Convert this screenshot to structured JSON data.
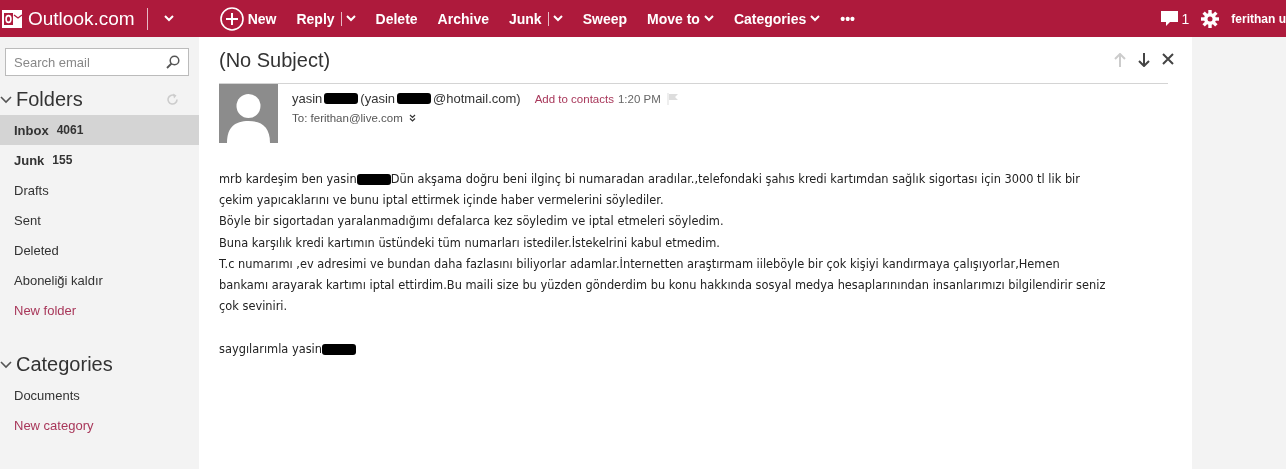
{
  "topbar": {
    "brand": "Outlook.com",
    "actions": [
      {
        "label": "New",
        "kind": "new"
      },
      {
        "label": "Reply",
        "kind": "split"
      },
      {
        "label": "Delete",
        "kind": "plain"
      },
      {
        "label": "Archive",
        "kind": "plain"
      },
      {
        "label": "Junk",
        "kind": "split"
      },
      {
        "label": "Sweep",
        "kind": "plain"
      },
      {
        "label": "Move to",
        "kind": "menu"
      },
      {
        "label": "Categories",
        "kind": "menu"
      },
      {
        "label": "•••",
        "kind": "plain"
      }
    ],
    "messages_count": "1",
    "user": "ferithan u"
  },
  "sidebar": {
    "search": {
      "placeholder": "Search email"
    },
    "folders_title": "Folders",
    "folders": [
      {
        "label": "Inbox",
        "count": "4061",
        "selected": true,
        "kind": "folder"
      },
      {
        "label": "Junk",
        "count": "155",
        "selected": false,
        "kind": "folder"
      },
      {
        "label": "Drafts",
        "selected": false,
        "kind": "folder"
      },
      {
        "label": "Sent",
        "selected": false,
        "kind": "folder"
      },
      {
        "label": "Deleted",
        "selected": false,
        "kind": "folder"
      },
      {
        "label": "Aboneliği kaldır",
        "selected": false,
        "kind": "folder"
      },
      {
        "label": "New folder",
        "selected": false,
        "kind": "link"
      }
    ],
    "categories_title": "Categories",
    "categories": [
      {
        "label": "Documents",
        "kind": "folder"
      },
      {
        "label": "New category",
        "kind": "link"
      }
    ]
  },
  "message": {
    "subject": "(No Subject)",
    "from": [
      {
        "kind": "text",
        "text": "yasin"
      },
      {
        "kind": "redaction"
      },
      {
        "kind": "text",
        "text": "(yasin"
      },
      {
        "kind": "redaction"
      },
      {
        "kind": "text",
        "text": "@hotmail.com)"
      }
    ],
    "add_contact": "Add to contacts",
    "time": "1:20 PM",
    "to": "To: ferithan@live.com",
    "body": [
      [
        [
          {
            "kind": "text",
            "text": "mrb kardeşim ben yasin"
          },
          {
            "kind": "redaction"
          },
          {
            "kind": "text",
            "text": "Dün akşama doğru beni ilginç bi numaradan aradılar.,telefondaki şahıs  kredi kartımdan sağlık sigortası için 3000 tl lik bir"
          }
        ],
        [
          {
            "kind": "text",
            "text": "çekim yapıcaklarını ve bunu iptal ettirmek içinde haber vermelerini söylediler."
          }
        ],
        [
          {
            "kind": "text",
            "text": "Böyle bir sigortadan yaralanmadığımı defalarca kez söyledim ve iptal etmeleri söyledim."
          }
        ],
        [
          {
            "kind": "text",
            "text": "Buna karşılık kredi kartımın üstündeki tüm numarları istediler.İstekelrini  kabul etmedim."
          }
        ],
        [
          {
            "kind": "text",
            "text": "T.c numarımı ,ev adresimi ve bundan daha fazlasını biliyorlar adamlar.İnternetten araştırmam iileböyle bir çok kişiyi kandırmaya çalışıyorlar,Hemen"
          }
        ],
        [
          {
            "kind": "text",
            "text": "bankamı arayarak kartımı iptal ettirdim.Bu maili size bu yüzden gönderdim bu konu hakkında sosyal medya hesaplarınından insanlarımızı bilgilendirir seniz"
          }
        ],
        [
          {
            "kind": "text",
            "text": "çok seviniri."
          }
        ]
      ],
      [
        [
          {
            "kind": "text",
            "text": "saygılarımla yasin"
          },
          {
            "kind": "redaction"
          }
        ]
      ]
    ]
  }
}
